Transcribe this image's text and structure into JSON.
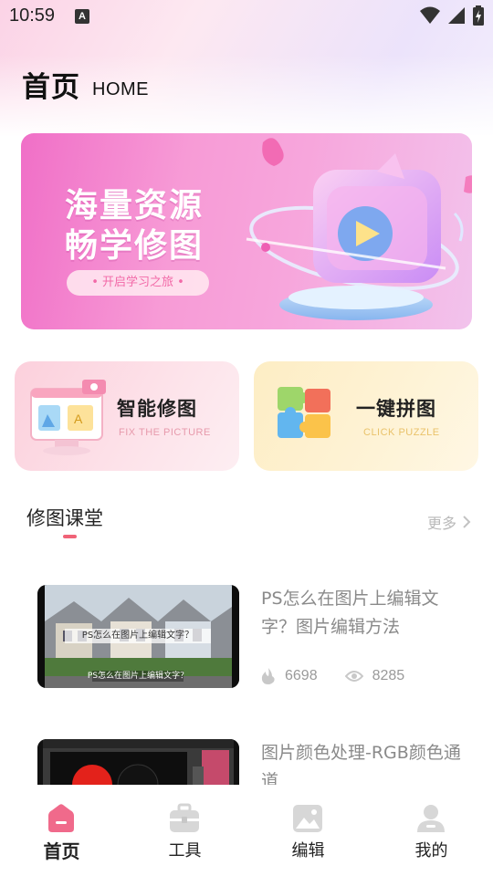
{
  "status_bar": {
    "time": "10:59",
    "app_badge": "A"
  },
  "header": {
    "title": "首页",
    "subtitle": "HOME"
  },
  "banner": {
    "line1": "海量资源",
    "line2": "畅学修图",
    "pill": "• 开启学习之旅 •"
  },
  "features": [
    {
      "title": "智能修图",
      "subtitle": "FIX THE PICTURE"
    },
    {
      "title": "一键拼图",
      "subtitle": "CLICK PUZZLE"
    }
  ],
  "section": {
    "title": "修图课堂",
    "more": "更多"
  },
  "courses": [
    {
      "title": "PS怎么在图片上编辑文字？图片编辑方法",
      "thumb_caption": "PS怎么在图片上编辑文字？",
      "likes": "6698",
      "views": "8285"
    },
    {
      "title": "图片颜色处理-RGB颜色通道"
    }
  ],
  "nav": {
    "items": [
      {
        "label": "首页",
        "icon": "home-icon",
        "active": true
      },
      {
        "label": "工具",
        "icon": "toolbox-icon"
      },
      {
        "label": "编辑",
        "icon": "image-edit-icon"
      },
      {
        "label": "我的",
        "icon": "profile-icon"
      }
    ]
  },
  "colors": {
    "accent": "#f06377",
    "nav_icon": "#d7d7d7",
    "banner_pink": "#f06fc7"
  }
}
